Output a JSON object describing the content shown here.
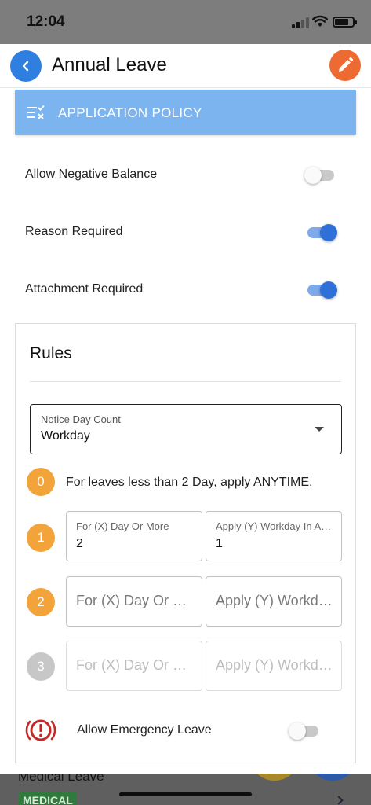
{
  "status": {
    "time": "12:04"
  },
  "header": {
    "title": "Annual Leave",
    "back_icon": "chevron-left-icon",
    "edit_icon": "pencil-icon"
  },
  "policy": {
    "title": "APPLICATION POLICY",
    "icon": "checklist-icon"
  },
  "settings": [
    {
      "label": "Allow Negative Balance",
      "enabled": false
    },
    {
      "label": "Reason Required",
      "enabled": true
    },
    {
      "label": "Attachment Required",
      "enabled": true
    }
  ],
  "rules": {
    "title": "Rules",
    "notice": {
      "label": "Notice Day Count",
      "value": "Workday"
    },
    "rule0": {
      "step": "0",
      "text": "For leaves less than 2 Day, apply ANYTIME."
    },
    "rows": [
      {
        "step": "1",
        "x_label": "For (X) Day Or More",
        "x_value": "2",
        "y_label": "Apply (Y) Workday In Advance",
        "y_value": "1"
      },
      {
        "step": "2",
        "x_placeholder": "For (X) Day Or More",
        "y_placeholder": "Apply (Y) Workday In Advance"
      },
      {
        "step": "3",
        "x_placeholder": "For (X) Day Or More",
        "y_placeholder": "Apply (Y) Workday In Advance"
      }
    ],
    "emergency": {
      "label": "Allow Emergency Leave",
      "enabled": false,
      "icon": "alert-circle-icon"
    }
  },
  "behind": {
    "title": "Medical Leave",
    "tag": "MEDICAL"
  },
  "colors": {
    "primary": "#2f70d8",
    "policy_bar": "#7cb4f0",
    "accent_orange": "#ed6a33",
    "step_orange": "#f2a33a",
    "step_grey": "#c7c7c7",
    "emergency_red": "#c62828"
  }
}
